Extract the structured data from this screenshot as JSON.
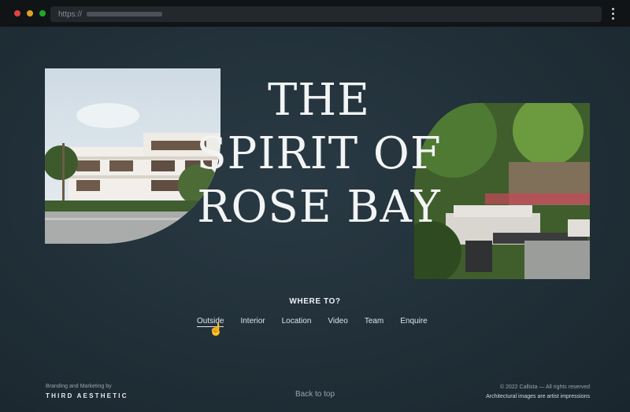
{
  "browser": {
    "url_scheme": "https://",
    "colors": {
      "close": "#e0443e",
      "minimize": "#dea123",
      "maximize": "#1aab29"
    }
  },
  "hero": {
    "lines": [
      "THE",
      "SPIRIT OF",
      "ROSE BAY"
    ]
  },
  "images": {
    "left": "building-exterior-photo",
    "right": "garden-terrace-photo"
  },
  "nav": {
    "title": "WHERE TO?",
    "items": [
      "Outside",
      "Interior",
      "Location",
      "Video",
      "Team",
      "Enquire"
    ]
  },
  "footer": {
    "credit_label": "Branding and Marketing by",
    "credit_brand": "THIRD AESTHETIC",
    "back_to_top": "Back to top",
    "copyright": "© 2022 Callista — All rights reserved",
    "disclaimer": "Architectural images are artist impressions"
  }
}
